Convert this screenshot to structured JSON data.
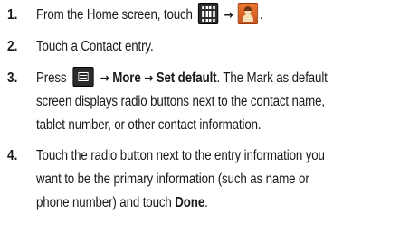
{
  "steps": [
    {
      "number": "1.",
      "segments": {
        "a": "From the Home screen, touch",
        "arrow1": "→",
        "icon1": "apps-grid-icon",
        "icon2": "contacts-icon",
        "end": "."
      }
    },
    {
      "number": "2.",
      "text": "Touch a Contact entry."
    },
    {
      "number": "3.",
      "segments": {
        "a": "Press",
        "icon1": "menu-key-icon",
        "arrow1": "→",
        "more": "More",
        "arrow2": "→",
        "set_default": "Set default",
        "rest1": ". The Mark as default",
        "line2": "screen displays radio buttons next to the contact name,",
        "line3": "tablet number, or other contact information."
      }
    },
    {
      "number": "4.",
      "segments": {
        "line1": "Touch the radio button next to the entry information you",
        "line2": "want to be the primary information (such as name or",
        "line3a": "phone number) and touch",
        "done": "Done",
        "line3b": "."
      }
    }
  ],
  "colors": {
    "text": "#1a1a1a",
    "icon_dark": "#2b2b2b",
    "contacts_orange": "#e9782f"
  }
}
